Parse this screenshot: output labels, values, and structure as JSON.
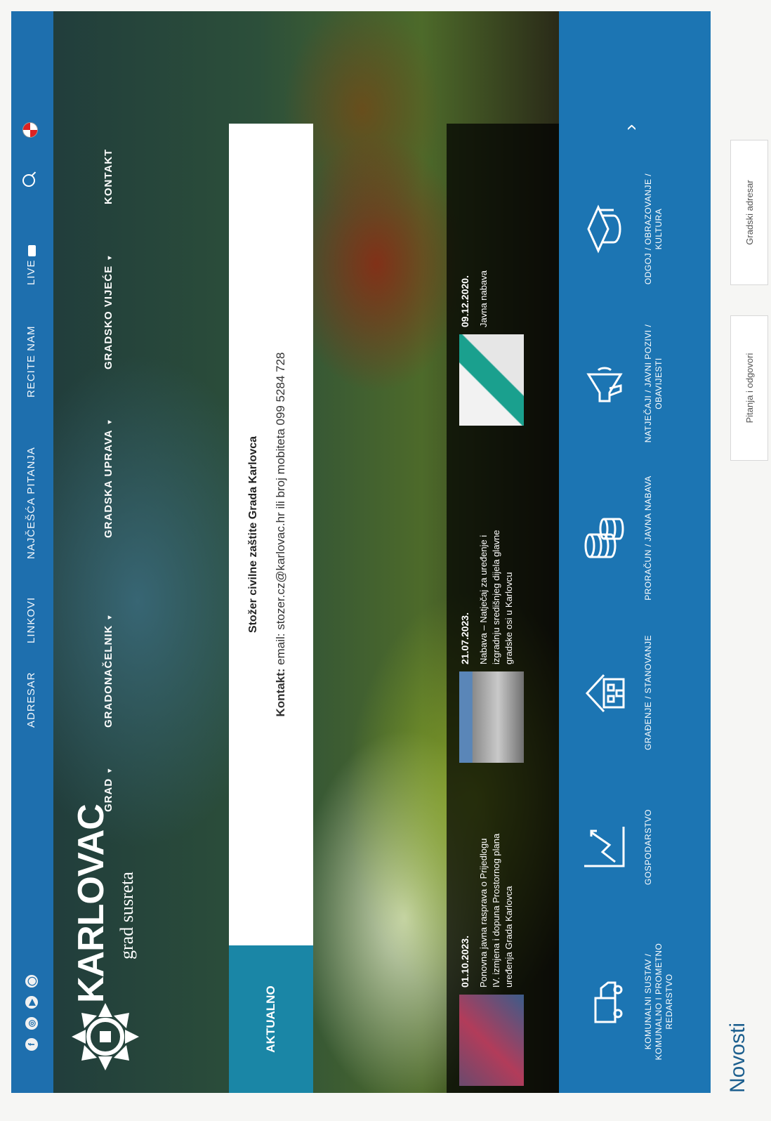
{
  "top_bar": {
    "social": [
      "f",
      "◎",
      "▶",
      "◯"
    ],
    "links": [
      "ADRESAR",
      "LINKOVI",
      "NAJČEŠĆA PITANJA",
      "RECITE NAM",
      "LIVE"
    ]
  },
  "brand": {
    "name": "KARLOVAC",
    "tagline": "grad susreta"
  },
  "main_nav": {
    "items": [
      "GRAD",
      "GRADONAČELNIK",
      "GRADSKA UPRAVA",
      "GRADSKO VIJEĆE",
      "KONTAKT"
    ],
    "caret": "▾"
  },
  "notice": {
    "tab_label": "AKTUALNO",
    "title": "Stožer civilne zaštite Grada Karlovca",
    "body_label": "Kontakt:",
    "body_text": " email: stozer.cz@karlovac.hr ili broj mobiteta 099 5284 728"
  },
  "news": [
    {
      "date": "01.10.2023.",
      "text": "Ponovna javna rasprava o Prijedlogu IV. izmjena i dopuna Prostornog plana uređenja Grada Karlovca"
    },
    {
      "date": "21.07.2023.",
      "text": "Nabava – Natječaj za uređenje i izgradnju središnjeg dijela glavne gradske osi u Karlovcu"
    },
    {
      "date": "09.12.2020.",
      "text": "Javna nabava"
    }
  ],
  "categories": [
    {
      "icon": "truck-icon",
      "label": "KOMUNALNI SUSTAV / KOMUNALNO I PROMETNO REDARSTVO"
    },
    {
      "icon": "chart-icon",
      "label": "GOSPODARSTVO"
    },
    {
      "icon": "building-icon",
      "label": "GRAĐENJE / STANOVANJE"
    },
    {
      "icon": "coins-icon",
      "label": "PRORAČUN / JAVNA NABAVA"
    },
    {
      "icon": "megaphone-icon",
      "label": "NATJEČAJI / JAVNI POZIVI / OBAVIJESTI"
    },
    {
      "icon": "graduation-cap-icon",
      "label": "ODGOJ / OBRAZOVANJE / KULTURA"
    }
  ],
  "next_arrow": "›",
  "sections": {
    "novosti": "Novosti",
    "qa_button": "Pitanja i odgovori",
    "directory_button": "Gradski adresar"
  },
  "colors": {
    "primary_blue": "#1c75b3",
    "teal_tab": "#1a86a6"
  }
}
